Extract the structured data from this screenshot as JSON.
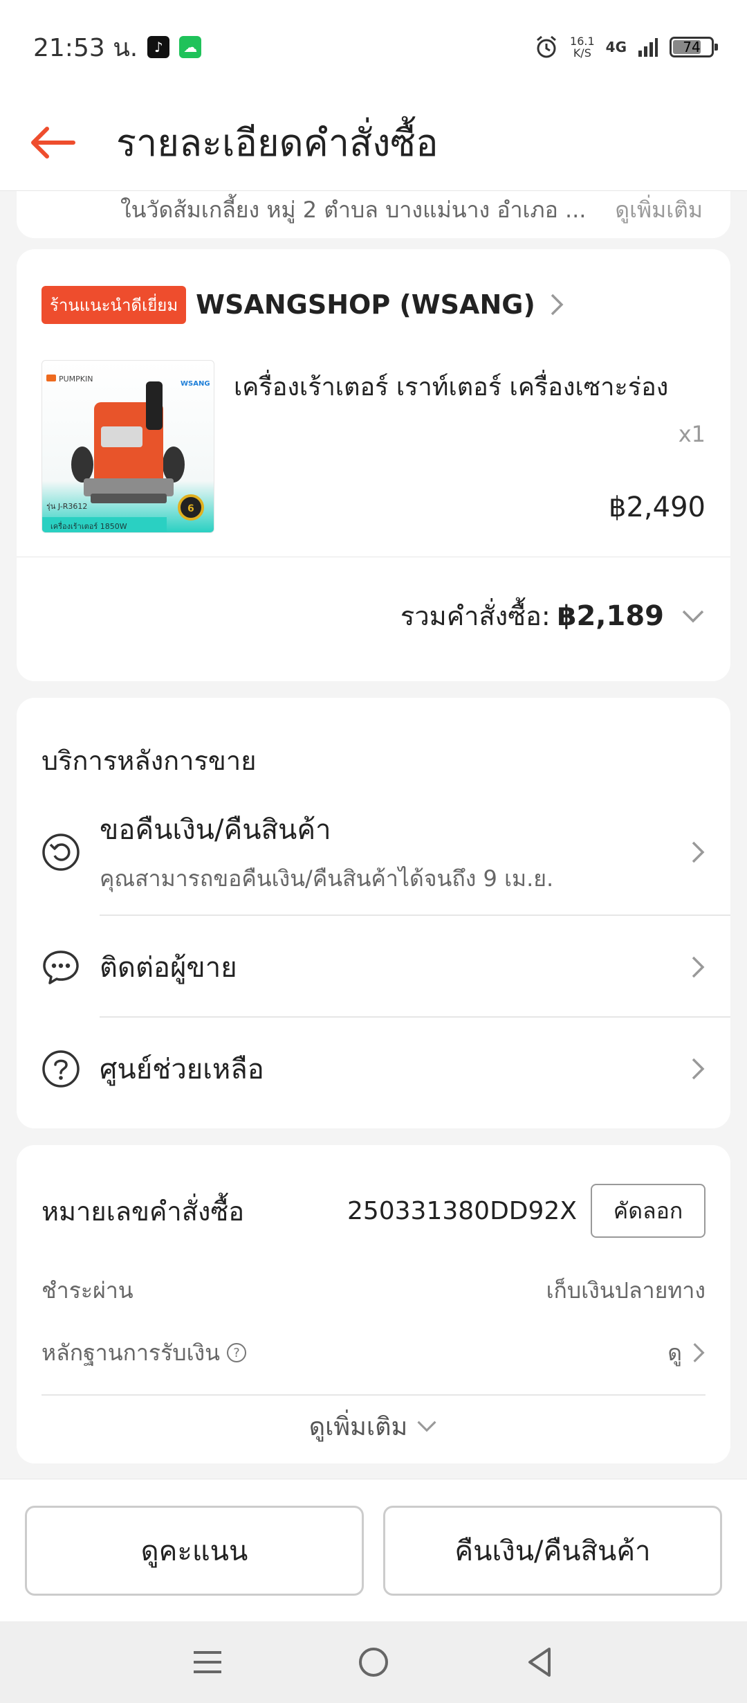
{
  "status_bar": {
    "time": "21:53 น.",
    "net_speed_value": "16.1",
    "net_speed_unit": "K/S",
    "network": "4G",
    "battery": "74"
  },
  "header": {
    "title": "รายละเอียดคำสั่งซื้อ"
  },
  "address": {
    "text": "ในวัดส้มเกลี้ยง หมู่ 2 ตำบล บางแม่นาง อำเภอ ...",
    "see_more": "ดูเพิ่มเติม"
  },
  "shop": {
    "badge": "ร้านแนะนำดีเยี่ยม",
    "name": "WSANGSHOP (WSANG)"
  },
  "product": {
    "name": "เครื่องเร้าเตอร์ เราท์เตอร์ เครื่องเซาะร่อง",
    "quantity": "x1",
    "price": "฿2,490",
    "thumb_brand": "PUMPKIN",
    "thumb_logo": "WSANG",
    "thumb_model": "รุ่น J-R3612",
    "thumb_caption": "เครื่องเร้าเตอร์ 1850W",
    "thumb_badge": "6"
  },
  "order_total": {
    "label": "รวมคำสั่งซื้อ:",
    "value": "฿2,189"
  },
  "after_sales": {
    "title": "บริการหลังการขาย",
    "items": [
      {
        "label": "ขอคืนเงิน/คืนสินค้า",
        "sub": "คุณสามารถขอคืนเงิน/คืนสินค้าได้จนถึง 9 เม.ย."
      },
      {
        "label": "ติดต่อผู้ขาย"
      },
      {
        "label": "ศูนย์ช่วยเหลือ"
      }
    ]
  },
  "order_info": {
    "order_number_label": "หมายเลขคำสั่งซื้อ",
    "order_number": "250331380DD92X",
    "copy_label": "คัดลอก",
    "payment_label": "ชำระผ่าน",
    "payment_value": "เก็บเงินปลายทาง",
    "proof_label": "หลักฐานการรับเงิน",
    "proof_help_icon": "?",
    "proof_value": "ดู",
    "see_more": "ดูเพิ่มเติม"
  },
  "actions": {
    "rate_label": "ดูคะแนน",
    "return_label": "คืนเงิน/คืนสินค้า"
  },
  "colors": {
    "accent": "#ee4d2d",
    "background": "#f4f4f4"
  }
}
